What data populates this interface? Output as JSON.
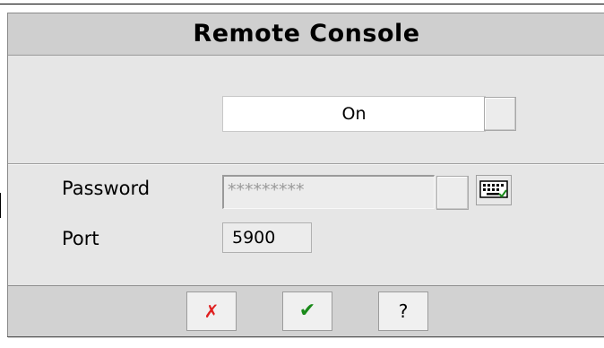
{
  "dialog": {
    "title": "Remote Console",
    "mode_value": "On",
    "password": {
      "label": "Password",
      "value": "*********"
    },
    "port": {
      "label": "Port",
      "value": "5900"
    },
    "buttons": {
      "cancel": "✗",
      "ok": "✔",
      "help": "?"
    }
  },
  "icons": {
    "keyboard": "keyboard-icon"
  },
  "colors": {
    "cancel": "#e02020",
    "ok": "#1a8a1a",
    "title_bar": "#cfcfcf",
    "panel": "#e6e6e6"
  }
}
